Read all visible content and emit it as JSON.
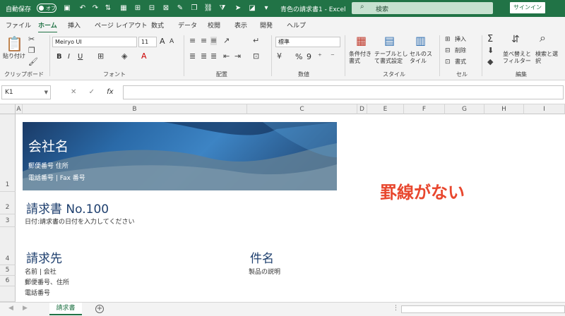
{
  "titlebar": {
    "autosave_label": "自動保存",
    "autosave_state": "オフ",
    "document_title": "青色の請求書1  -  Excel",
    "search_placeholder": "検索",
    "signin_label": "サインイン"
  },
  "ribbon_tabs": [
    "ファイル",
    "ホーム",
    "挿入",
    "ページ レイアウト",
    "数式",
    "データ",
    "校閲",
    "表示",
    "開発",
    "ヘルプ"
  ],
  "ribbon": {
    "clipboard": {
      "paste": "貼り付け",
      "label": "クリップボード"
    },
    "font": {
      "name": "Meiryo UI",
      "size": "11",
      "label": "フォント",
      "bold": "B",
      "italic": "I",
      "underline": "U",
      "grow": "A",
      "shrink": "A"
    },
    "alignment": {
      "label": "配置"
    },
    "number": {
      "format": "標準",
      "label": "数値",
      "percent": "%",
      "comma": "9"
    },
    "styles": {
      "conditional": "条件付き書式",
      "table": "テーブルとして書式設定",
      "cell": "セルのスタイル",
      "label": "スタイル"
    },
    "cells": {
      "insert": "挿入",
      "delete": "削除",
      "format": "書式",
      "label": "セル"
    },
    "editing": {
      "sort": "並べ替えとフィルター",
      "find": "検索と選択",
      "label": "編集",
      "sum": "Σ"
    }
  },
  "formula_bar": {
    "name_box": "K1",
    "fx": "fx",
    "cancel": "✕",
    "enter": "✓"
  },
  "columns": [
    "A",
    "B",
    "C",
    "D",
    "E",
    "F",
    "G",
    "H",
    "I"
  ],
  "rows": [
    "1",
    "2",
    "3",
    "4",
    "5",
    "6"
  ],
  "sheet": {
    "company_name": "会社名",
    "company_address": "郵便番号 住所",
    "company_contact": "電話番号 | Fax 番号",
    "annotation": "罫線がない",
    "invoice_title": "請求書 No.100",
    "date_prompt": "日付:請求書の日付を入力してください",
    "bill_to_heading": "請求先",
    "bill_to_name": "名前 | 会社",
    "bill_to_address": "郵便番号、住所",
    "bill_to_phone": "電話番号",
    "subject_heading": "件名",
    "subject_desc": "製品の説明"
  },
  "sheet_tabs": {
    "active": "請求書",
    "add": "+"
  },
  "colors": {
    "excel_green": "#217346",
    "navy_text": "#1e3f6e",
    "annotation_red": "#e8472e"
  }
}
